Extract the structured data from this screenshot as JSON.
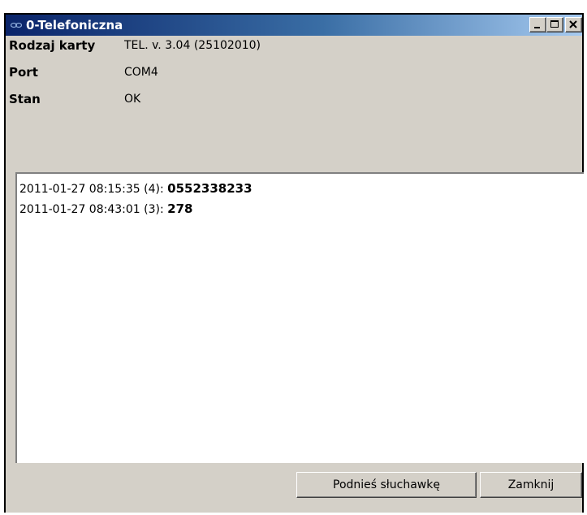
{
  "window": {
    "title": "0-Telefoniczna",
    "titlebar_colors": [
      "#0a246a",
      "#a6caf0"
    ],
    "controls": [
      "minimize-icon",
      "maximize-icon",
      "close-icon"
    ]
  },
  "info": [
    {
      "label": "Rodzaj karty",
      "value": "TEL. v. 3.04 (25102010)"
    },
    {
      "label": "Port",
      "value": "COM4"
    },
    {
      "label": "Stan",
      "value": "OK"
    }
  ],
  "log": [
    {
      "prefix": "2011-01-27 08:15:35 (4): ",
      "number": "0552338233"
    },
    {
      "prefix": "2011-01-27 08:43:01 (3): ",
      "number": "278"
    }
  ],
  "buttons": {
    "answer": "Podnieś słuchawkę",
    "close": "Zamknij"
  }
}
